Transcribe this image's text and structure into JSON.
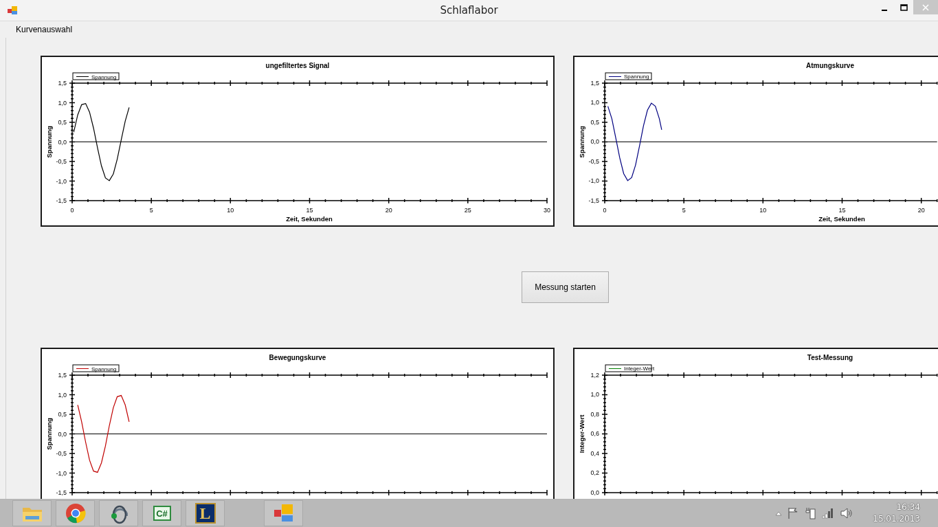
{
  "window": {
    "title": "Schlaflabor"
  },
  "menu": [
    {
      "label": "Kurvenauswahl"
    }
  ],
  "charts": [
    {
      "chart_data": {
        "type": "line",
        "title": "ungefiltertes Signal",
        "xlabel": "Zeit, Sekunden",
        "ylabel": "Spannung",
        "x": [
          0.1,
          0.35,
          0.6,
          0.85,
          1.1,
          1.35,
          1.6,
          1.85,
          2.1,
          2.35,
          2.6,
          2.85,
          3.1,
          3.35,
          3.6
        ],
        "series": [
          {
            "name": "Spannung",
            "color": "#000000",
            "values": [
              0.25,
              0.69,
              0.95,
              0.98,
              0.76,
              0.35,
              -0.15,
              -0.61,
              -0.92,
              -0.99,
              -0.82,
              -0.44,
              0.05,
              0.53,
              0.88
            ]
          }
        ],
        "xlim": [
          0,
          30
        ],
        "ylim": [
          -1.5,
          1.5
        ],
        "xticks": [
          0,
          5,
          10,
          15,
          20,
          25,
          30
        ],
        "yticks": [
          {
            "value": -1.5,
            "label": "-1,5"
          },
          {
            "value": -1,
            "label": "-1,0"
          },
          {
            "value": -0.5,
            "label": "-0,5"
          },
          {
            "value": 0,
            "label": "0,0"
          },
          {
            "value": 0.5,
            "label": "0,5"
          },
          {
            "value": 1,
            "label": "1,0"
          },
          {
            "value": 1.5,
            "label": "1,5"
          }
        ]
      }
    },
    {
      "chart_data": {
        "type": "line",
        "title": "Atmungskurve",
        "xlabel": "Zeit, Sekunden",
        "ylabel": "Spannung",
        "x": [
          0.2,
          0.45,
          0.7,
          0.95,
          1.2,
          1.45,
          1.7,
          1.95,
          2.2,
          2.45,
          2.7,
          2.95,
          3.2,
          3.45,
          3.6
        ],
        "series": [
          {
            "name": "Spannung",
            "color": "#000080",
            "values": [
              0.91,
              0.59,
              0.1,
              -0.41,
              -0.81,
              -0.99,
              -0.91,
              -0.59,
              -0.1,
              0.41,
              0.81,
              0.99,
              0.91,
              0.59,
              0.31
            ]
          }
        ],
        "xlim": [
          0,
          21
        ],
        "ylim": [
          -1.5,
          1.5
        ],
        "xticks": [
          0,
          5,
          10,
          15,
          20
        ],
        "yticks": [
          {
            "value": -1.5,
            "label": "-1,5"
          },
          {
            "value": -1,
            "label": "-1,0"
          },
          {
            "value": -0.5,
            "label": "-0,5"
          },
          {
            "value": 0,
            "label": "0,0"
          },
          {
            "value": 0.5,
            "label": "0,5"
          },
          {
            "value": 1,
            "label": "1,0"
          },
          {
            "value": 1.5,
            "label": "1,5"
          }
        ]
      }
    },
    {
      "chart_data": {
        "type": "line",
        "title": "Bewegungskurve",
        "ylabel": "Spannung",
        "x": [
          0.35,
          0.6,
          0.85,
          1.1,
          1.35,
          1.6,
          1.85,
          2.1,
          2.35,
          2.6,
          2.85,
          3.1,
          3.35,
          3.6
        ],
        "series": [
          {
            "name": "Spannung",
            "color": "#c00000",
            "values": [
              0.74,
              0.31,
              -0.21,
              -0.67,
              -0.95,
              -0.98,
              -0.74,
              -0.31,
              0.21,
              0.67,
              0.95,
              0.98,
              0.74,
              0.31
            ]
          }
        ],
        "xlim": [
          0,
          30
        ],
        "ylim": [
          -1.5,
          1.5
        ],
        "yticks": [
          {
            "value": -1.5,
            "label": "-1,5"
          },
          {
            "value": -1,
            "label": "-1,0"
          },
          {
            "value": -0.5,
            "label": "-0,5"
          },
          {
            "value": 0,
            "label": "0,0"
          },
          {
            "value": 0.5,
            "label": "0,5"
          },
          {
            "value": 1,
            "label": "1,0"
          },
          {
            "value": 1.5,
            "label": "1,5"
          }
        ]
      }
    },
    {
      "chart_data": {
        "type": "line",
        "title": "Test-Messung",
        "ylabel": "Integer-Wert",
        "series": [
          {
            "name": "Integer-Wert",
            "color": "#008000"
          }
        ],
        "ylim": [
          0,
          1.2
        ],
        "yticks": [
          {
            "value": 0,
            "label": "0,0"
          },
          {
            "value": 0.2,
            "label": "0,2"
          },
          {
            "value": 0.4,
            "label": "0,4"
          },
          {
            "value": 0.6,
            "label": "0,6"
          },
          {
            "value": 0.8,
            "label": "0,8"
          },
          {
            "value": 1,
            "label": "1,0"
          },
          {
            "value": 1.2,
            "label": "1,2"
          }
        ]
      }
    }
  ],
  "start_button": {
    "label": "Messung starten"
  },
  "taskbar": {
    "apps": [
      {
        "kind": "folder"
      },
      {
        "kind": "browser"
      },
      {
        "kind": "headset"
      },
      {
        "kind": "code",
        "label": "C#"
      },
      {
        "kind": "game",
        "label": "L"
      },
      {
        "kind": "form"
      }
    ],
    "tray": {
      "time": "16:34",
      "date": "15.01.2013"
    }
  }
}
